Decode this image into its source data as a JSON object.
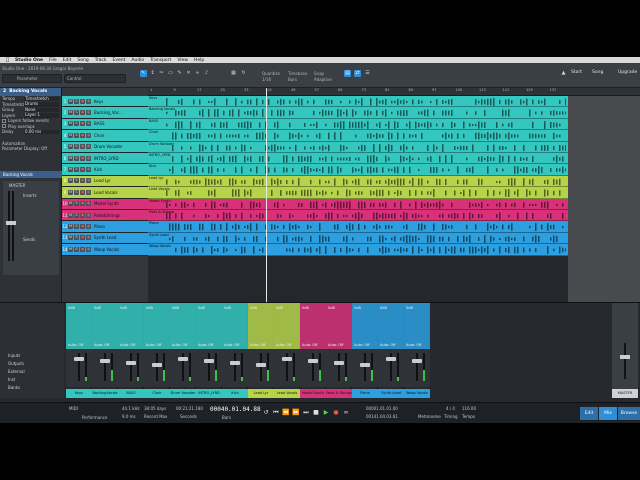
{
  "menubar": {
    "app_name": "Studio One",
    "items": [
      "File",
      "Edit",
      "Song",
      "Track",
      "Event",
      "Audio",
      "Transport",
      "View",
      "Help"
    ]
  },
  "toolbar": {
    "parameter_label": "Parameter",
    "control_label": "Control",
    "window_title": "Studio One - 2019-08-30 Gregor Beyerle",
    "quantize_label": "Quantize",
    "quantize_value": "1/16",
    "timebase_label": "Timebase",
    "timebase_value": "Bars",
    "snap_label": "Snap",
    "snap_value": "Adaptive",
    "start_label": "Start",
    "song_label": "Song",
    "upgrade_label": "Upgrade"
  },
  "inspector": {
    "track_number": "2",
    "track_name": "Backing Vocals",
    "rows": [
      {
        "key": "Tempo",
        "value": "Timestretch"
      },
      {
        "key": "Timestretch",
        "value": "Drums"
      },
      {
        "key": "Group",
        "value": "None"
      },
      {
        "key": "Layers",
        "value": "Layer 1"
      },
      {
        "key": "Layers follow events",
        "value": ""
      },
      {
        "key": "Play overlaps",
        "value": ""
      },
      {
        "key": "Delay",
        "value": "0.00 ms"
      }
    ],
    "automation_label": "Automation",
    "parameter_label": "Parameter",
    "display_label": "Display: Off",
    "channel_name": "Backing Vocals",
    "master_label": "MASTER",
    "inserts_label": "Inserts",
    "sends_label": "Sends",
    "bottom_name": "Backing Vocals",
    "bottom_rows": [
      {
        "key": "Start",
        "value": "00001.01.01.00"
      },
      {
        "key": "End",
        "value": "00141.04.03.61"
      },
      {
        "key": "File Tempo",
        "value": "120.00"
      },
      {
        "key": "Speedup",
        "value": "1.00"
      }
    ]
  },
  "tracks": [
    {
      "num": "1",
      "name": "Keys",
      "color": "#34c7c0"
    },
    {
      "num": "2",
      "name": "Backing_Voc...",
      "color": "#34c7c0"
    },
    {
      "num": "3",
      "name": "BASS",
      "color": "#34c7c0"
    },
    {
      "num": "4",
      "name": "Choir",
      "color": "#34c7c0"
    },
    {
      "num": "5",
      "name": "Drum Vocoder",
      "color": "#34c7c0"
    },
    {
      "num": "6",
      "name": "INTRO_LYRD",
      "color": "#34c7c0"
    },
    {
      "num": "7",
      "name": "Kick",
      "color": "#34c7c0"
    },
    {
      "num": "8",
      "name": "Lead Lyr",
      "color": "#b5d44a"
    },
    {
      "num": "9",
      "name": "Lead Vocals",
      "color": "#b5d44a"
    },
    {
      "num": "10",
      "name": "Model Synth",
      "color": "#d8317a"
    },
    {
      "num": "11",
      "name": "Pads&Strings",
      "color": "#d8317a"
    },
    {
      "num": "12",
      "name": "Piano",
      "color": "#2b9fe0"
    },
    {
      "num": "13",
      "name": "Synth Lead",
      "color": "#2b9fe0"
    },
    {
      "num": "14",
      "name": "Woop Vocals",
      "color": "#2b9fe0"
    }
  ],
  "lane_labels": [
    "Keys",
    "Backing Vocals",
    "BASS",
    "Choir",
    "Drum Vocoder",
    "INTRO_LYRD",
    "Kick",
    "Lead Lyr",
    "Lead Vocals",
    "Model Synth",
    "Pads & Strings",
    "Piano",
    "Synth Lead",
    "Woop Vocals"
  ],
  "ruler_ticks": [
    "1",
    "9",
    "17",
    "25",
    "33",
    "41",
    "49",
    "57",
    "65",
    "73",
    "81",
    "89",
    "97",
    "105",
    "113",
    "121",
    "129",
    "137"
  ],
  "mixer": {
    "strips": [
      {
        "name": "Keys",
        "color": "#34c7c0",
        "value": "0dB"
      },
      {
        "name": "BackingVocals",
        "color": "#34c7c0",
        "value": "0dB"
      },
      {
        "name": "BASS",
        "color": "#34c7c0",
        "value": "0dB"
      },
      {
        "name": "Choir",
        "color": "#34c7c0",
        "value": "0dB"
      },
      {
        "name": "Drum Vocoder",
        "color": "#34c7c0",
        "value": "0dB"
      },
      {
        "name": "INTRO_LYRD",
        "color": "#34c7c0",
        "value": "0dB"
      },
      {
        "name": "Kick",
        "color": "#34c7c0",
        "value": "0dB"
      },
      {
        "name": "Lead Lyr",
        "color": "#b5d44a",
        "value": "0dB"
      },
      {
        "name": "Lead Vocals",
        "color": "#b5d44a",
        "value": "0dB"
      },
      {
        "name": "Model Synth",
        "color": "#d8317a",
        "value": "0dB"
      },
      {
        "name": "Pads & Strings",
        "color": "#d8317a",
        "value": "0dB"
      },
      {
        "name": "Piano",
        "color": "#2b9fe0",
        "value": "0dB"
      },
      {
        "name": "Synth Lead",
        "color": "#2b9fe0",
        "value": "0dB"
      },
      {
        "name": "Woop Vocals",
        "color": "#2b9fe0",
        "value": "0dB"
      }
    ],
    "side_labels": [
      "Inputs",
      "Outputs",
      "External",
      "Inst",
      "Banks"
    ],
    "auto_label": "Auto: Off",
    "master_name": "MASTER"
  },
  "transport": {
    "sample_rate": "44.1 kHz",
    "latency": "9.0 ms",
    "record_time": "38:05 days",
    "record_label": "Record Max",
    "time_display": "00:21:21.180",
    "seconds_label": "Seconds",
    "position": "00040.01.04.88",
    "bars_label": "Bars",
    "loop_start": "00001.01.01.00",
    "loop_end": "00141.04.03.61",
    "metronome_label": "Metronome",
    "time_signature": "4 / 4",
    "timing_label": "Timing",
    "tempo": "116.00",
    "tempo_label": "Tempo",
    "midi_label": "MIDI",
    "performance_label": "Performance",
    "edit_label": "Edit",
    "mix_label": "Mix",
    "browse_label": "Browse"
  },
  "colors": {
    "teal": "#34c7c0",
    "lime": "#b5d44a",
    "magenta": "#d8317a",
    "blue": "#2b9fe0",
    "accent": "#2f8fd6"
  }
}
